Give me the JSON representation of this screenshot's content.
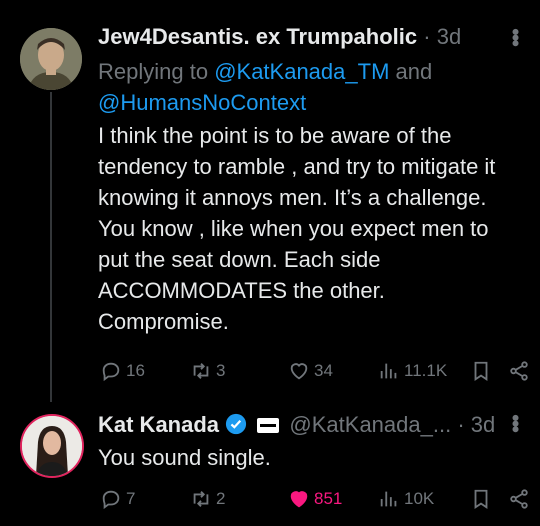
{
  "tweets": [
    {
      "display_name": "Jew4Desantis. ex Trumpaholic",
      "time": "· 3d",
      "replying_prefix": "Replying to ",
      "reply_handle_1": "@KatKanada_TM",
      "reply_and": " and",
      "reply_handle_2": "@HumansNoContext",
      "text": "I think the point is to be aware of the\ntendency to ramble , and try to mitigate it\nknowing it annoys men. It’s a challenge.\nYou know , like when you expect men to\nput the seat down. Each side\nACCOMMODATES the other.\nCompromise.",
      "stats": {
        "replies": "16",
        "retweets": "3",
        "likes": "34",
        "views": "11.1K"
      }
    },
    {
      "display_name": "Kat Kanada",
      "handle": "@KatKanada_...",
      "time": "· 3d",
      "text": "You sound single.",
      "stats": {
        "replies": "7",
        "retweets": "2",
        "likes": "851",
        "views": "10K"
      }
    }
  ],
  "icons": [
    "more-icon",
    "reply-icon",
    "retweet-icon",
    "like-icon",
    "views-icon",
    "bookmark-icon",
    "share-icon",
    "verified-badge-icon"
  ],
  "colors": {
    "link": "#1d9bf0",
    "muted": "#71767b",
    "liked": "#f91880",
    "background": "#000000"
  }
}
